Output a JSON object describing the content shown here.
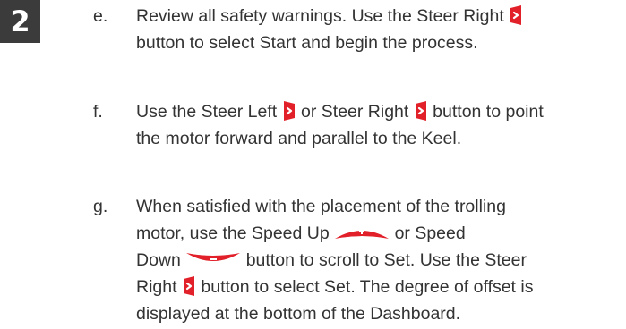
{
  "step": {
    "number": "2"
  },
  "icons": {
    "steer_right": "steer-right-button-icon",
    "steer_left": "steer-left-button-icon",
    "speed_up": "speed-up-button-icon",
    "speed_down": "speed-down-button-icon",
    "accent_color": "#e2202a"
  },
  "items": [
    {
      "letter": "e.",
      "line1_a": "Review all safety warnings. Use the Steer Right",
      "line2": "button to select Start and begin the process."
    },
    {
      "letter": "f.",
      "line1_a": "Use the Steer Left",
      "line1_b": "or Steer Right",
      "line1_c": "button to point",
      "line2": "the motor forward and parallel to the Keel."
    },
    {
      "letter": "g.",
      "line1": "When satisfied with the placement of the trolling",
      "line2_a": "motor, use the Speed Up",
      "line2_b": "or Speed",
      "line3_a": "Down",
      "line3_b": "button to scroll to Set. Use the Steer",
      "line4_a": "Right",
      "line4_b": "button to select Set. The degree of offset is",
      "line5": "displayed at the bottom of the Dashboard."
    }
  ]
}
